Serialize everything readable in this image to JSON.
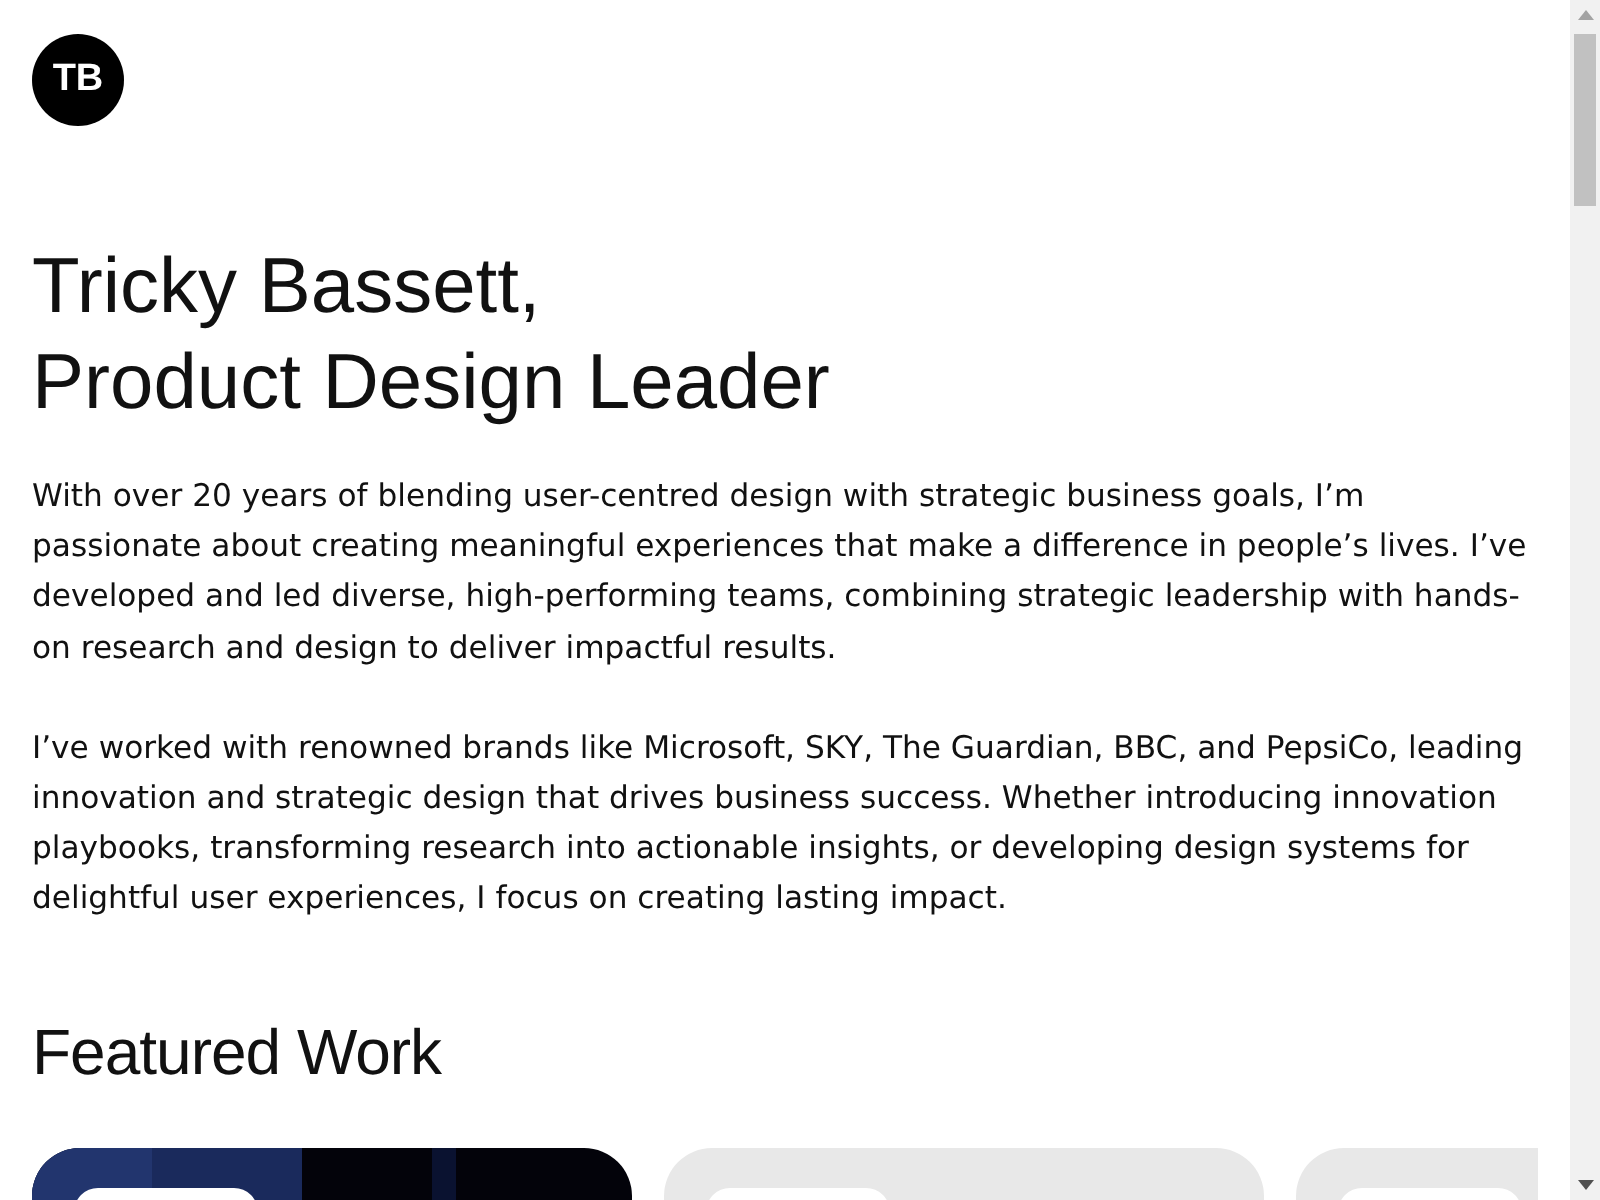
{
  "logo": {
    "initials": "TB"
  },
  "heading": {
    "lines": [
      "Tricky Bassett,",
      "Product Design Leader"
    ]
  },
  "intro": [
    "With over 20 years of blending user-centred design with strategic business goals, I’m passionate about creating meaningful experiences that make a difference in people’s lives. I’ve developed and led diverse, high-performing teams, combining strategic leadership with hands-on research and design to deliver impactful results.",
    "I’ve worked with renowned brands like Microsoft, SKY, The Guardian, BBC, and PepsiCo, leading innovation and strategic design that drives business success. Whether introducing innovation playbooks, transforming research into actionable insights, or developing design systems for delightful user experiences, I focus on creating lasting impact."
  ],
  "featured": {
    "title": "Featured Work",
    "cards": [
      {
        "kind": "picture"
      },
      {
        "kind": "plain"
      },
      {
        "kind": "plain"
      }
    ]
  }
}
